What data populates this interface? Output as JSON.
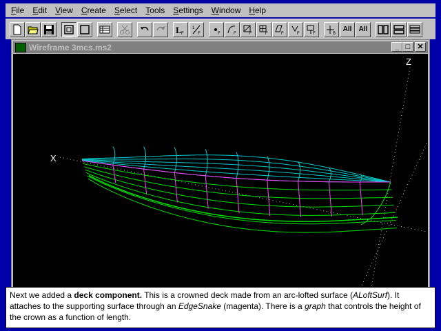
{
  "menu": [
    {
      "key": "F",
      "rest": "ile"
    },
    {
      "key": "E",
      "rest": "dit"
    },
    {
      "key": "V",
      "rest": "iew"
    },
    {
      "key": "C",
      "rest": "reate"
    },
    {
      "key": "S",
      "rest": "elect"
    },
    {
      "key": "T",
      "rest": "ools"
    },
    {
      "key": "S",
      "rest": "ettings",
      "underline_first": true
    },
    {
      "key": "W",
      "rest": "indow"
    },
    {
      "key": "H",
      "rest": "elp"
    }
  ],
  "toolbar": {
    "new_icon": "new-document-icon",
    "open_icon": "open-folder-icon",
    "save_icon": "save-disk-icon",
    "all_label_1": "All",
    "all_label_2": "All"
  },
  "window": {
    "title": "Wireframe 3mcs.ms2",
    "minimize": "_",
    "maximize": "□",
    "close": "✕"
  },
  "viewport": {
    "axis_z": "Z",
    "axis_x": "X",
    "hull_color": "#00e000",
    "deck_color": "#00c8c8",
    "edge_color": "#ff40ff",
    "axis_color": "#ffffff"
  },
  "caption": {
    "p1": "Next we added a ",
    "b1": "deck component.",
    "p2": " This is a crowned deck made from an arc-lofted surface (",
    "i1": "ALoftSurf",
    "p3": "). It attaches to the supporting surface through an ",
    "i2": "EdgeSnake",
    "p4": " (magenta). There is a ",
    "i3": "graph",
    "p5": " that controls the height of the crown as a function of length."
  }
}
